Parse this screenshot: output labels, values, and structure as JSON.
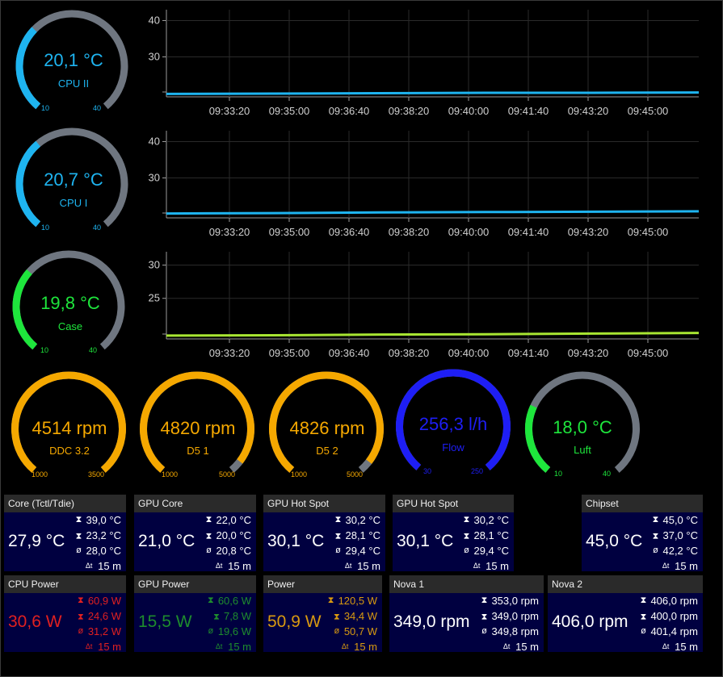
{
  "gauges": [
    {
      "id": "cpu-ii",
      "value": "20,1 °C",
      "name": "CPU II",
      "min": "10",
      "max": "40",
      "level": 0.337,
      "color": "#1eb4f0",
      "textColor": "#1eb4f0"
    },
    {
      "id": "cpu-i",
      "value": "20,7 °C",
      "name": "CPU I",
      "min": "10",
      "max": "40",
      "level": 0.357,
      "color": "#1eb4f0",
      "textColor": "#1eb4f0"
    },
    {
      "id": "case",
      "value": "19,8 °C",
      "name": "Case",
      "min": "10",
      "max": "40",
      "level": 0.327,
      "color": "#1ee63c",
      "textColor": "#1ee63c"
    },
    {
      "id": "ddc",
      "value": "4514 rpm",
      "name": "DDC 3.2",
      "min": "1000",
      "max": "3500",
      "level": 1,
      "color": "#f5a800",
      "textColor": "#f5a800"
    },
    {
      "id": "d5-1",
      "value": "4820 rpm",
      "name": "D5 1",
      "min": "1000",
      "max": "5000",
      "level": 0.955,
      "color": "#f5a800",
      "textColor": "#f5a800"
    },
    {
      "id": "d5-2",
      "value": "4826 rpm",
      "name": "D5 2",
      "min": "1000",
      "max": "5000",
      "level": 0.956,
      "color": "#f5a800",
      "textColor": "#f5a800"
    },
    {
      "id": "flow",
      "value": "256,3 l/h",
      "name": "Flow",
      "min": "30",
      "max": "250",
      "level": 1,
      "color": "#1e1ef5",
      "textColor": "#1e1ef5"
    },
    {
      "id": "luft",
      "value": "18,0 °C",
      "name": "Luft",
      "min": "10",
      "max": "40",
      "level": 0.267,
      "color": "#1ee63c",
      "textColor": "#1ee63c"
    }
  ],
  "charts": [
    {
      "id": "cpu-ii-chart",
      "yticks": [
        "40",
        "30"
      ],
      "yvals": [
        40,
        30
      ],
      "ymin": 19,
      "ymax": 43,
      "color": "#1eb4f0",
      "series": [
        [
          0,
          19.8
        ],
        [
          0.2,
          19.9
        ],
        [
          0.4,
          20.0
        ],
        [
          0.6,
          20.1
        ],
        [
          0.8,
          20.1
        ],
        [
          1,
          20.2
        ]
      ],
      "xticks": [
        "09:33:20",
        "09:35:00",
        "09:36:40",
        "09:38:20",
        "09:40:00",
        "09:41:40",
        "09:43:20",
        "09:45:00"
      ]
    },
    {
      "id": "cpu-i-chart",
      "yticks": [
        "40",
        "30"
      ],
      "yvals": [
        40,
        30
      ],
      "ymin": 19,
      "ymax": 43,
      "color": "#1eb4f0",
      "series": [
        [
          0,
          20.2
        ],
        [
          0.2,
          20.3
        ],
        [
          0.4,
          20.5
        ],
        [
          0.6,
          20.6
        ],
        [
          0.8,
          20.7
        ],
        [
          1,
          20.8
        ]
      ],
      "xticks": [
        "09:33:20",
        "09:35:00",
        "09:36:40",
        "09:38:20",
        "09:40:00",
        "09:41:40",
        "09:43:20",
        "09:45:00"
      ]
    },
    {
      "id": "case-chart",
      "yticks": [
        "30",
        "25"
      ],
      "yvals": [
        30,
        25
      ],
      "ymin": 18.9,
      "ymax": 32,
      "color": "#a8e632",
      "series": [
        [
          0,
          19.4
        ],
        [
          0.2,
          19.45
        ],
        [
          0.4,
          19.55
        ],
        [
          0.6,
          19.6
        ],
        [
          0.8,
          19.7
        ],
        [
          1,
          19.8
        ]
      ],
      "xticks": [
        "09:33:20",
        "09:35:00",
        "09:36:40",
        "09:38:20",
        "09:40:00",
        "09:41:40",
        "09:43:20",
        "09:45:00"
      ]
    }
  ],
  "panels": [
    {
      "id": "core-tctl",
      "title": "Core (Tctl/Tdie)",
      "value": "27,9 °C",
      "max": "39,0 °C",
      "min": "23,2 °C",
      "avg": "28,0 °C",
      "period": "15 m",
      "valueColor": "#ffffff",
      "statColor": "#ffffff",
      "iconColor": "#ffffff"
    },
    {
      "id": "gpu-core",
      "title": "GPU Core",
      "value": "21,0 °C",
      "max": "22,0 °C",
      "min": "20,0 °C",
      "avg": "20,8 °C",
      "period": "15 m",
      "valueColor": "#ffffff",
      "statColor": "#ffffff",
      "iconColor": "#ffffff"
    },
    {
      "id": "gpu-hotspot-1",
      "title": "GPU Hot Spot",
      "value": "30,1 °C",
      "max": "30,2 °C",
      "min": "28,1 °C",
      "avg": "29,4 °C",
      "period": "15 m",
      "valueColor": "#ffffff",
      "statColor": "#ffffff",
      "iconColor": "#ffffff"
    },
    {
      "id": "gpu-hotspot-2",
      "title": "GPU Hot Spot",
      "value": "30,1 °C",
      "max": "30,2 °C",
      "min": "28,1 °C",
      "avg": "29,4 °C",
      "period": "15 m",
      "valueColor": "#ffffff",
      "statColor": "#ffffff",
      "iconColor": "#ffffff"
    },
    {
      "id": "chipset",
      "title": "Chipset",
      "value": "45,0 °C",
      "max": "45,0 °C",
      "min": "37,0 °C",
      "avg": "42,2 °C",
      "period": "15 m",
      "valueColor": "#ffffff",
      "statColor": "#ffffff",
      "iconColor": "#ffffff"
    },
    {
      "id": "cpu-power",
      "title": "CPU Power",
      "value": "30,6 W",
      "max": "60,9 W",
      "min": "24,6 W",
      "avg": "31,2 W",
      "period": "15 m",
      "valueColor": "#e02020",
      "statColor": "#e02020",
      "iconColor": "#e02020"
    },
    {
      "id": "gpu-power",
      "title": "GPU Power",
      "value": "15,5 W",
      "max": "60,6 W",
      "min": "7,8 W",
      "avg": "19,6 W",
      "period": "15 m",
      "valueColor": "#1e8c2d",
      "statColor": "#1e8c2d",
      "iconColor": "#1e8c2d"
    },
    {
      "id": "power",
      "title": "Power",
      "value": "50,9 W",
      "max": "120,5 W",
      "min": "34,4 W",
      "avg": "50,7 W",
      "period": "15 m",
      "valueColor": "#d99a10",
      "statColor": "#d99a10",
      "iconColor": "#d99a10"
    },
    {
      "id": "nova-1",
      "title": "Nova 1",
      "value": "349,0 rpm",
      "max": "353,0 rpm",
      "min": "349,0 rpm",
      "avg": "349,8 rpm",
      "period": "15 m",
      "valueColor": "#ffffff",
      "statColor": "#ffffff",
      "iconColor": "#ffffff"
    },
    {
      "id": "nova-2",
      "title": "Nova 2",
      "value": "406,0 rpm",
      "max": "406,0 rpm",
      "min": "400,0 rpm",
      "avg": "401,4 rpm",
      "period": "15 m",
      "valueColor": "#ffffff",
      "statColor": "#ffffff",
      "iconColor": "#ffffff"
    }
  ],
  "icons": {
    "max": "max-icon",
    "min": "min-icon",
    "avg": "avg-icon",
    "period": "period-icon"
  }
}
